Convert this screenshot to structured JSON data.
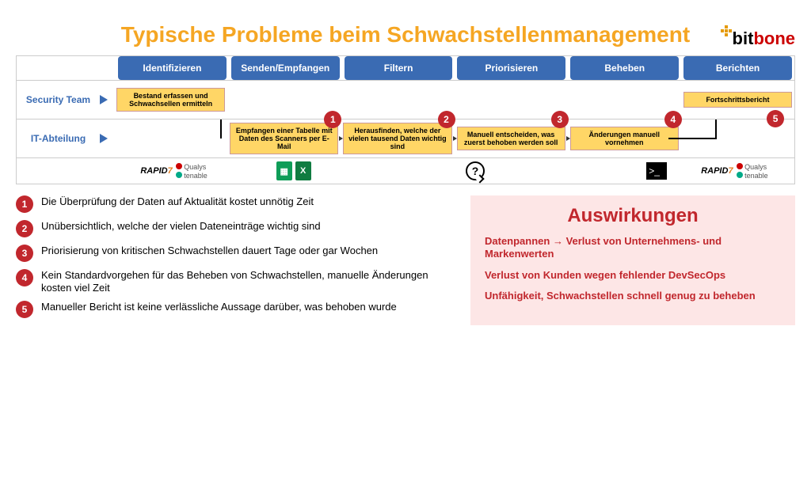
{
  "logo": {
    "part1": "bit",
    "part2": "bone"
  },
  "title": "Typische Probleme beim Schwachstellenmanagement",
  "headers": [
    "Identifizieren",
    "Senden/Empfangen",
    "Filtern",
    "Priorisieren",
    "Beheben",
    "Berichten"
  ],
  "rows": {
    "security": {
      "label": "Security Team",
      "boxes": [
        "Bestand erfassen und Schwachsellen ermitteln",
        null,
        null,
        null,
        null,
        "Fortschrittsbericht"
      ]
    },
    "it": {
      "label": "IT-Abteilung",
      "boxes": [
        null,
        "Empfangen einer Tabelle mit Daten des Scanners per E-Mail",
        "Herausfinden, welche der vielen tausend Daten wichtig sind",
        "Manuell entscheiden, was zuerst behoben werden soll",
        "Änderungen manuell vornehmen",
        null
      ],
      "badges": [
        null,
        "1",
        "2",
        "3",
        "4",
        "5"
      ]
    }
  },
  "tools": {
    "rapid": "RAPID",
    "rapid7": "7",
    "qualys": "Qualys",
    "tenable": "tenable",
    "question": "?",
    "terminal": ">_"
  },
  "problems": [
    "Die Überprüfung der Daten auf Aktualität kostet unnötig Zeit",
    "Unübersichtlich, welche der vielen Dateneinträge wichtig sind",
    "Priorisierung von kritischen Schwachstellen dauert Tage oder gar Wochen",
    "Kein Standardvorgehen für das Beheben von Schwachstellen, manuelle Änderungen kosten viel  Zeit",
    "Manueller Bericht ist keine verlässliche Aussage darüber, was behoben wurde"
  ],
  "impact": {
    "title": "Auswirkungen",
    "items": [
      "Datenpannen → Verlust von Unternehmens- und Markenwerten",
      "Verlust von Kunden wegen fehlender DevSecOps",
      "Unfähigkeit, Schwachstellen schnell genug zu beheben"
    ]
  }
}
